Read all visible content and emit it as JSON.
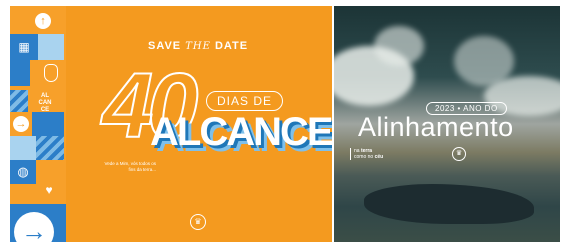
{
  "left_card": {
    "header_left": "SAVE",
    "header_mid": "THE",
    "header_right": "DATE",
    "number": "40",
    "pill": "DIAS DE",
    "title": "ALCANCE",
    "sidebar_word": "AL\nCAN\nCE",
    "verse": "Vede a Mim, vós todos os fins da terra...",
    "icons": [
      "arrow-up-icon",
      "grid-icon",
      "shield-icon",
      "arrow-right-icon",
      "globe-icon",
      "heart-icon",
      "crown-icon",
      "arrow-right-big-icon"
    ]
  },
  "right_card": {
    "year_pill": "2023 • ANO DO",
    "title": "Alinhamento",
    "slogan_line1_pre": "na ",
    "slogan_line1_bold": "terra",
    "slogan_line2_pre": "como no ",
    "slogan_line2_bold": "céu"
  },
  "colors": {
    "orange": "#f49a1f",
    "blue": "#2c7ec8",
    "light_blue": "#a9d3ef",
    "white": "#ffffff"
  }
}
